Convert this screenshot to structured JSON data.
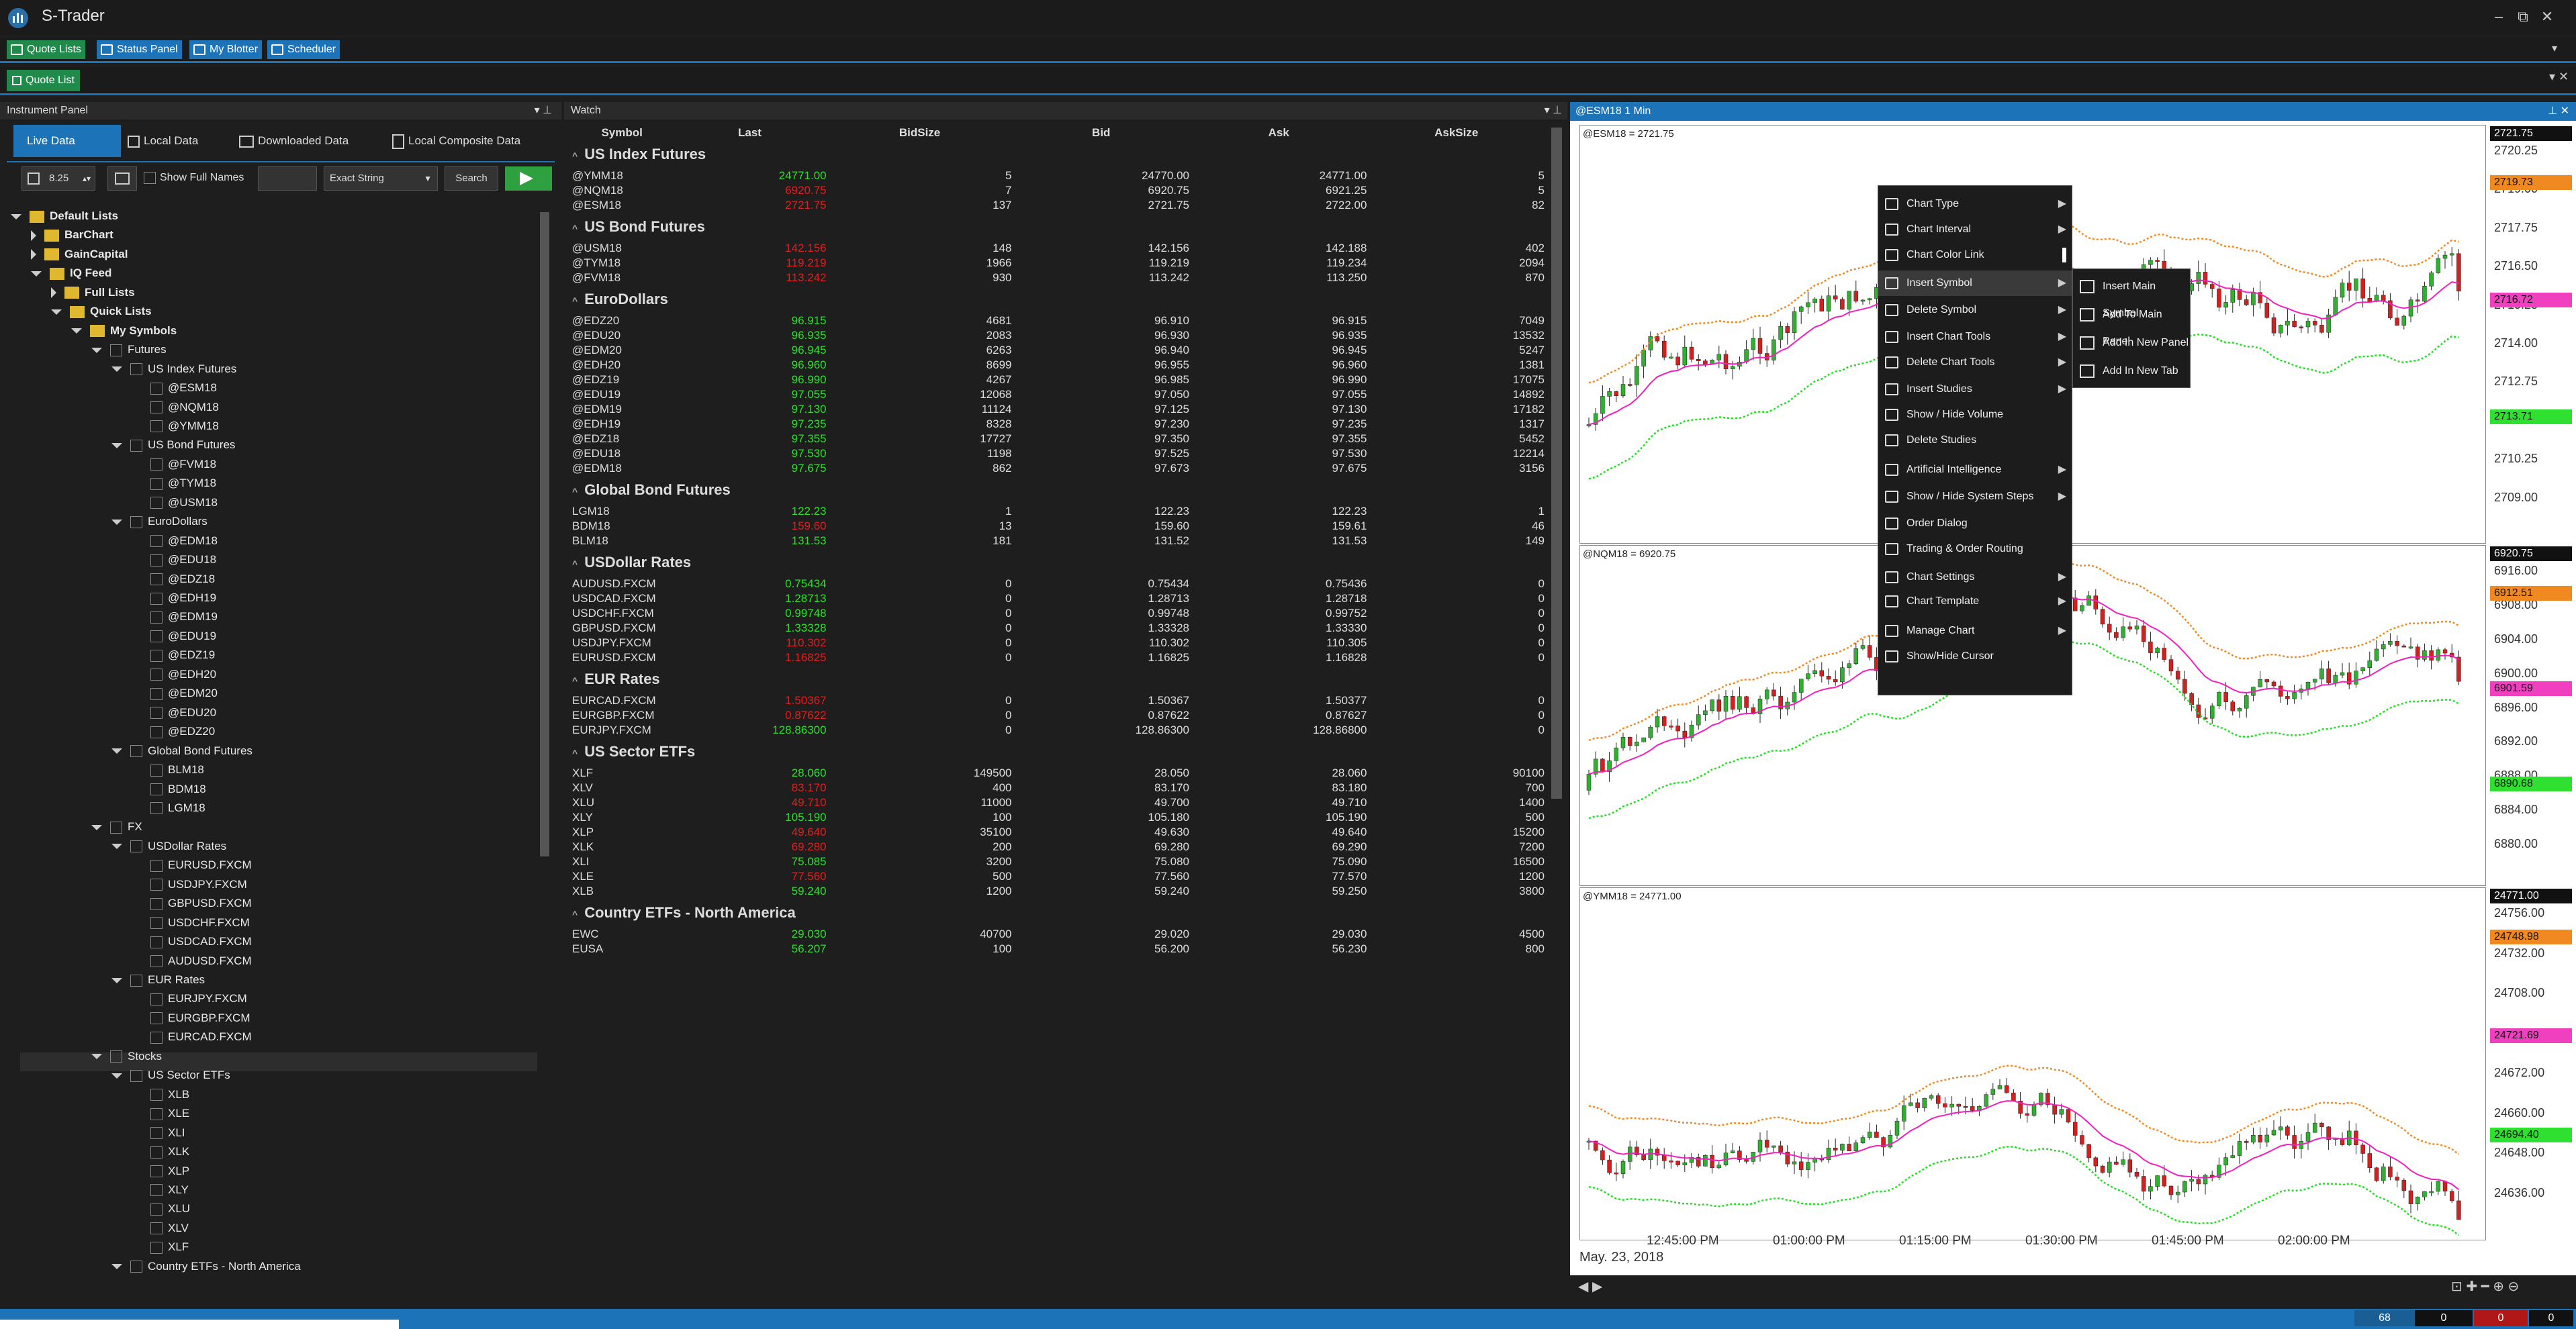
{
  "app": {
    "title": "S-Trader",
    "icon": "trader-logo-icon"
  },
  "toolbar": {
    "items": [
      {
        "label": "Quote Lists",
        "icon": "list-icon",
        "active": true
      },
      {
        "label": "Status Panel",
        "icon": "monitor-icon"
      },
      {
        "label": "My Blotter",
        "icon": "blotter-icon"
      },
      {
        "label": "Scheduler",
        "icon": "calendar-icon"
      }
    ]
  },
  "doc_tab": {
    "label": "Quote List",
    "icon": "quote-list-icon"
  },
  "instrument_panel": {
    "title": "Instrument Panel",
    "tabs": [
      {
        "label": "Live Data",
        "active": true
      },
      {
        "label": "Local Data"
      },
      {
        "label": "Downloaded Data"
      },
      {
        "label": "Local Composite Data"
      }
    ],
    "font_size": "8.25",
    "show_full_names_label": "Show Full Names",
    "search_mode": "Exact String",
    "search_label": "Search"
  },
  "tree": [
    {
      "t": "Default Lists",
      "lvl": 0,
      "k": "folder",
      "bold": true,
      "tri": "down"
    },
    {
      "t": "BarChart",
      "lvl": 1,
      "k": "folder",
      "bold": true,
      "tri": "right"
    },
    {
      "t": "GainCapital",
      "lvl": 1,
      "k": "folder",
      "bold": true,
      "tri": "right"
    },
    {
      "t": "IQ Feed",
      "lvl": 1,
      "k": "folder",
      "bold": true,
      "tri": "down"
    },
    {
      "t": "Full Lists",
      "lvl": 2,
      "k": "folder",
      "bold": true,
      "tri": "right"
    },
    {
      "t": "Quick Lists",
      "lvl": 2,
      "k": "folder",
      "bold": true,
      "tri": "down"
    },
    {
      "t": "My Symbols",
      "lvl": 3,
      "k": "folder",
      "bold": true,
      "tri": "down"
    },
    {
      "t": "Futures",
      "lvl": 4,
      "k": "cb",
      "tri": "down"
    },
    {
      "t": "US Index Futures",
      "lvl": 5,
      "k": "cb",
      "tri": "down"
    },
    {
      "t": "@ESM18",
      "lvl": 6,
      "k": "cb"
    },
    {
      "t": "@NQM18",
      "lvl": 6,
      "k": "cb"
    },
    {
      "t": "@YMM18",
      "lvl": 6,
      "k": "cb"
    },
    {
      "t": "US Bond Futures",
      "lvl": 5,
      "k": "cb",
      "tri": "down"
    },
    {
      "t": "@FVM18",
      "lvl": 6,
      "k": "cb"
    },
    {
      "t": "@TYM18",
      "lvl": 6,
      "k": "cb"
    },
    {
      "t": "@USM18",
      "lvl": 6,
      "k": "cb"
    },
    {
      "t": "EuroDollars",
      "lvl": 5,
      "k": "cb",
      "tri": "down"
    },
    {
      "t": "@EDM18",
      "lvl": 6,
      "k": "cb"
    },
    {
      "t": "@EDU18",
      "lvl": 6,
      "k": "cb"
    },
    {
      "t": "@EDZ18",
      "lvl": 6,
      "k": "cb"
    },
    {
      "t": "@EDH19",
      "lvl": 6,
      "k": "cb"
    },
    {
      "t": "@EDM19",
      "lvl": 6,
      "k": "cb"
    },
    {
      "t": "@EDU19",
      "lvl": 6,
      "k": "cb"
    },
    {
      "t": "@EDZ19",
      "lvl": 6,
      "k": "cb"
    },
    {
      "t": "@EDH20",
      "lvl": 6,
      "k": "cb"
    },
    {
      "t": "@EDM20",
      "lvl": 6,
      "k": "cb"
    },
    {
      "t": "@EDU20",
      "lvl": 6,
      "k": "cb"
    },
    {
      "t": "@EDZ20",
      "lvl": 6,
      "k": "cb"
    },
    {
      "t": "Global Bond Futures",
      "lvl": 5,
      "k": "cb",
      "tri": "down"
    },
    {
      "t": "BLM18",
      "lvl": 6,
      "k": "cb"
    },
    {
      "t": "BDM18",
      "lvl": 6,
      "k": "cb"
    },
    {
      "t": "LGM18",
      "lvl": 6,
      "k": "cb"
    },
    {
      "t": "FX",
      "lvl": 4,
      "k": "cb",
      "tri": "down"
    },
    {
      "t": "USDollar Rates",
      "lvl": 5,
      "k": "cb",
      "tri": "down"
    },
    {
      "t": "EURUSD.FXCM",
      "lvl": 6,
      "k": "cb"
    },
    {
      "t": "USDJPY.FXCM",
      "lvl": 6,
      "k": "cb"
    },
    {
      "t": "GBPUSD.FXCM",
      "lvl": 6,
      "k": "cb"
    },
    {
      "t": "USDCHF.FXCM",
      "lvl": 6,
      "k": "cb"
    },
    {
      "t": "USDCAD.FXCM",
      "lvl": 6,
      "k": "cb"
    },
    {
      "t": "AUDUSD.FXCM",
      "lvl": 6,
      "k": "cb"
    },
    {
      "t": "EUR Rates",
      "lvl": 5,
      "k": "cb",
      "tri": "down"
    },
    {
      "t": "EURJPY.FXCM",
      "lvl": 6,
      "k": "cb"
    },
    {
      "t": "EURGBP.FXCM",
      "lvl": 6,
      "k": "cb"
    },
    {
      "t": "EURCAD.FXCM",
      "lvl": 6,
      "k": "cb"
    },
    {
      "t": "Stocks",
      "lvl": 4,
      "k": "cb",
      "tri": "down",
      "selected": true
    },
    {
      "t": "US Sector ETFs",
      "lvl": 5,
      "k": "cb",
      "tri": "down"
    },
    {
      "t": "XLB",
      "lvl": 6,
      "k": "cb"
    },
    {
      "t": "XLE",
      "lvl": 6,
      "k": "cb"
    },
    {
      "t": "XLI",
      "lvl": 6,
      "k": "cb"
    },
    {
      "t": "XLK",
      "lvl": 6,
      "k": "cb"
    },
    {
      "t": "XLP",
      "lvl": 6,
      "k": "cb"
    },
    {
      "t": "XLY",
      "lvl": 6,
      "k": "cb"
    },
    {
      "t": "XLU",
      "lvl": 6,
      "k": "cb"
    },
    {
      "t": "XLV",
      "lvl": 6,
      "k": "cb"
    },
    {
      "t": "XLF",
      "lvl": 6,
      "k": "cb"
    },
    {
      "t": "Country ETFs - North America",
      "lvl": 5,
      "k": "cb",
      "tri": "down"
    }
  ],
  "watch": {
    "title": "Watch",
    "columns": [
      "Symbol",
      "Last",
      "BidSize",
      "Bid",
      "Ask",
      "AskSize"
    ],
    "groups": [
      {
        "name": "US Index Futures",
        "rows": [
          [
            "@YMM18",
            "24771.00",
            "5",
            "24770.00",
            "24771.00",
            "5",
            "up"
          ],
          [
            "@NQM18",
            "6920.75",
            "7",
            "6920.75",
            "6921.25",
            "5",
            "dn"
          ],
          [
            "@ESM18",
            "2721.75",
            "137",
            "2721.75",
            "2722.00",
            "82",
            "dn"
          ]
        ]
      },
      {
        "name": "US Bond Futures",
        "rows": [
          [
            "@USM18",
            "142.156",
            "148",
            "142.156",
            "142.188",
            "402",
            "dn"
          ],
          [
            "@TYM18",
            "119.219",
            "1966",
            "119.219",
            "119.234",
            "2094",
            "dn"
          ],
          [
            "@FVM18",
            "113.242",
            "930",
            "113.242",
            "113.250",
            "870",
            "dn"
          ]
        ]
      },
      {
        "name": "EuroDollars",
        "rows": [
          [
            "@EDZ20",
            "96.915",
            "4681",
            "96.910",
            "96.915",
            "7049",
            "up"
          ],
          [
            "@EDU20",
            "96.935",
            "2083",
            "96.930",
            "96.935",
            "13532",
            "up"
          ],
          [
            "@EDM20",
            "96.945",
            "6263",
            "96.940",
            "96.945",
            "5247",
            "up"
          ],
          [
            "@EDH20",
            "96.960",
            "8699",
            "96.955",
            "96.960",
            "1381",
            "up"
          ],
          [
            "@EDZ19",
            "96.990",
            "4267",
            "96.985",
            "96.990",
            "17075",
            "up"
          ],
          [
            "@EDU19",
            "97.055",
            "12068",
            "97.050",
            "97.055",
            "14892",
            "up"
          ],
          [
            "@EDM19",
            "97.130",
            "11124",
            "97.125",
            "97.130",
            "17182",
            "up"
          ],
          [
            "@EDH19",
            "97.235",
            "8328",
            "97.230",
            "97.235",
            "1317",
            "up"
          ],
          [
            "@EDZ18",
            "97.355",
            "17727",
            "97.350",
            "97.355",
            "5452",
            "up"
          ],
          [
            "@EDU18",
            "97.530",
            "1198",
            "97.525",
            "97.530",
            "12214",
            "up"
          ],
          [
            "@EDM18",
            "97.675",
            "862",
            "97.673",
            "97.675",
            "3156",
            "up"
          ]
        ]
      },
      {
        "name": "Global Bond Futures",
        "rows": [
          [
            "LGM18",
            "122.23",
            "1",
            "122.23",
            "122.23",
            "1",
            "up"
          ],
          [
            "BDM18",
            "159.60",
            "13",
            "159.60",
            "159.61",
            "46",
            "dn"
          ],
          [
            "BLM18",
            "131.53",
            "181",
            "131.52",
            "131.53",
            "149",
            "up"
          ]
        ]
      },
      {
        "name": "USDollar Rates",
        "rows": [
          [
            "AUDUSD.FXCM",
            "0.75434",
            "0",
            "0.75434",
            "0.75436",
            "0",
            "up"
          ],
          [
            "USDCAD.FXCM",
            "1.28713",
            "0",
            "1.28713",
            "1.28718",
            "0",
            "up"
          ],
          [
            "USDCHF.FXCM",
            "0.99748",
            "0",
            "0.99748",
            "0.99752",
            "0",
            "up"
          ],
          [
            "GBPUSD.FXCM",
            "1.33328",
            "0",
            "1.33328",
            "1.33330",
            "0",
            "up"
          ],
          [
            "USDJPY.FXCM",
            "110.302",
            "0",
            "110.302",
            "110.305",
            "0",
            "dn"
          ],
          [
            "EURUSD.FXCM",
            "1.16825",
            "0",
            "1.16825",
            "1.16828",
            "0",
            "dn"
          ]
        ]
      },
      {
        "name": "EUR Rates",
        "rows": [
          [
            "EURCAD.FXCM",
            "1.50367",
            "0",
            "1.50367",
            "1.50377",
            "0",
            "dn"
          ],
          [
            "EURGBP.FXCM",
            "0.87622",
            "0",
            "0.87622",
            "0.87627",
            "0",
            "dn"
          ],
          [
            "EURJPY.FXCM",
            "128.86300",
            "0",
            "128.86300",
            "128.86800",
            "0",
            "up"
          ]
        ]
      },
      {
        "name": "US Sector ETFs",
        "rows": [
          [
            "XLF",
            "28.060",
            "149500",
            "28.050",
            "28.060",
            "90100",
            "up"
          ],
          [
            "XLV",
            "83.170",
            "400",
            "83.170",
            "83.180",
            "700",
            "dn"
          ],
          [
            "XLU",
            "49.710",
            "11000",
            "49.700",
            "49.710",
            "1400",
            "dn"
          ],
          [
            "XLY",
            "105.190",
            "100",
            "105.180",
            "105.190",
            "500",
            "up"
          ],
          [
            "XLP",
            "49.640",
            "35100",
            "49.630",
            "49.640",
            "15200",
            "dn"
          ],
          [
            "XLK",
            "69.280",
            "200",
            "69.280",
            "69.290",
            "7200",
            "dn"
          ],
          [
            "XLI",
            "75.085",
            "3200",
            "75.080",
            "75.090",
            "16500",
            "up"
          ],
          [
            "XLE",
            "77.560",
            "500",
            "77.560",
            "77.570",
            "1200",
            "dn"
          ],
          [
            "XLB",
            "59.240",
            "1200",
            "59.240",
            "59.250",
            "3800",
            "up"
          ]
        ]
      },
      {
        "name": "Country ETFs - North America",
        "rows": [
          [
            "EWC",
            "29.030",
            "40700",
            "29.020",
            "29.030",
            "4500",
            "up"
          ],
          [
            "EUSA",
            "56.207",
            "100",
            "56.200",
            "56.230",
            "800",
            "up"
          ]
        ]
      }
    ]
  },
  "chart": {
    "title": "@ESM18 1 Min",
    "date_label": "May. 23, 2018",
    "time_ticks": [
      "12:45:00 PM",
      "01:00:00 PM",
      "01:15:00 PM",
      "01:30:00 PM",
      "01:45:00 PM",
      "02:00:00 PM"
    ],
    "panes": [
      {
        "label": "@ESM18 = 2721.75",
        "ticks": [
          "2720.25",
          "2719.00",
          "2717.75",
          "2716.50",
          "2715.25",
          "2714.00",
          "2712.75",
          "2711.50",
          "2710.25",
          "2709.00"
        ],
        "tags": [
          {
            "v": "2719.73",
            "c": "#f08a20"
          },
          {
            "v": "2716.72",
            "c": "#f040c0"
          },
          {
            "v": "2713.71",
            "c": "#30e030"
          }
        ],
        "last": "2721.75"
      },
      {
        "label": "@NQM18 = 6920.75",
        "ticks": [
          "6916.00",
          "6908.00",
          "6904.00",
          "6900.00",
          "6896.00",
          "6892.00",
          "6888.00",
          "6884.00",
          "6880.00"
        ],
        "tags": [
          {
            "v": "6912.51",
            "c": "#f08a20"
          },
          {
            "v": "6901.59",
            "c": "#f040c0"
          },
          {
            "v": "6890.68",
            "c": "#30e030"
          }
        ],
        "last": "6920.75"
      },
      {
        "label": "@YMM18 = 24771.00",
        "ticks": [
          "24756.00",
          "24732.00",
          "24708.00",
          "24684.00",
          "24672.00",
          "24660.00",
          "24648.00",
          "24636.00"
        ],
        "tags": [
          {
            "v": "24748.98",
            "c": "#f08a20"
          },
          {
            "v": "24721.69",
            "c": "#f040c0"
          },
          {
            "v": "24694.40",
            "c": "#30e030"
          }
        ],
        "last": "24771.00"
      }
    ]
  },
  "context_menu": [
    {
      "label": "Chart Type",
      "sub": true
    },
    {
      "label": "Chart Interval",
      "sub": true
    },
    {
      "label": "Chart Color Link",
      "sub": false
    },
    {
      "label": "Insert Symbol",
      "sub": true
    },
    {
      "label": "Delete Symbol",
      "sub": true
    },
    {
      "label": "Insert Chart Tools",
      "sub": true
    },
    {
      "label": "Delete Chart Tools",
      "sub": true
    },
    {
      "label": "Insert Studies",
      "sub": true
    },
    {
      "label": "Show / Hide Volume",
      "sub": false
    },
    {
      "label": "Delete Studies",
      "sub": false
    },
    {
      "label": "Artificial Intelligence",
      "sub": true
    },
    {
      "label": "Show / Hide System Steps",
      "sub": true
    },
    {
      "label": "Order Dialog",
      "sub": false
    },
    {
      "label": "Trading & Order Routing",
      "sub": false
    },
    {
      "label": "Chart Settings",
      "sub": true
    },
    {
      "label": "Chart Template",
      "sub": true
    },
    {
      "label": "Manage Chart",
      "sub": true
    },
    {
      "label": "Show/Hide Cursor",
      "sub": false
    }
  ],
  "submenu": [
    "Insert Main Symbol",
    "Add To Main Panel",
    "Add In New Panel",
    "Add In New Tab"
  ],
  "status": {
    "boxes": [
      "68",
      "0",
      "0",
      "0"
    ]
  }
}
